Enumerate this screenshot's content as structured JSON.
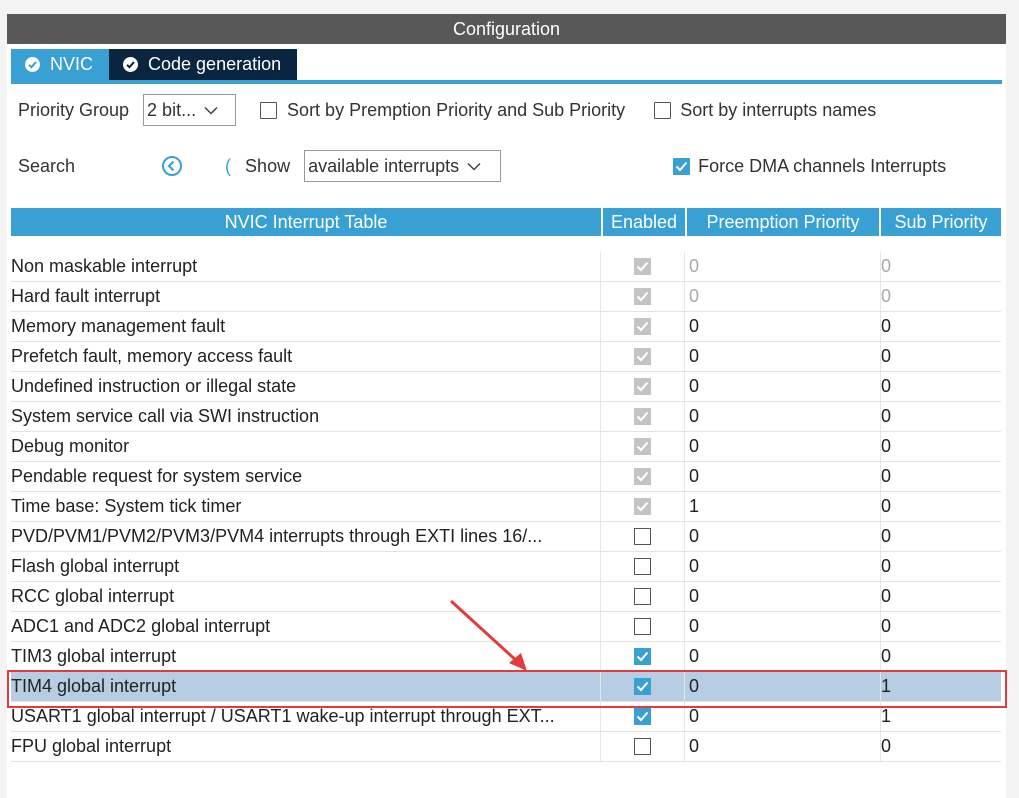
{
  "header": {
    "title": "Configuration"
  },
  "tabs": [
    {
      "label": "NVIC",
      "active": true,
      "icon": "check-circle-icon"
    },
    {
      "label": "Code generation",
      "active": false,
      "icon": "check-circle-icon"
    }
  ],
  "controls": {
    "priority_group_label": "Priority Group",
    "priority_group_value": "2 bit...",
    "sort_premption_label": "Sort by Premption Priority and Sub Priority",
    "sort_premption_checked": false,
    "sort_names_label": "Sort by interrupts names",
    "sort_names_checked": false,
    "search_label": "Search",
    "search_prev_icon": "chevron-left-circle-icon",
    "search_next_glyph": "(",
    "show_label": "Show",
    "show_value": "available interrupts",
    "force_dma_label": "Force DMA channels Interrupts",
    "force_dma_checked": true
  },
  "table": {
    "headers": {
      "name": "NVIC Interrupt Table",
      "enabled": "Enabled",
      "preemption": "Preemption Priority",
      "sub": "Sub Priority"
    },
    "rows": [
      {
        "name": "Non maskable interrupt",
        "enabled": "locked",
        "preemption": "0",
        "sub": "0",
        "muted": true
      },
      {
        "name": "Hard fault interrupt",
        "enabled": "locked",
        "preemption": "0",
        "sub": "0",
        "muted": true
      },
      {
        "name": "Memory management fault",
        "enabled": "locked",
        "preemption": "0",
        "sub": "0"
      },
      {
        "name": "Prefetch fault, memory access fault",
        "enabled": "locked",
        "preemption": "0",
        "sub": "0"
      },
      {
        "name": "Undefined instruction or illegal state",
        "enabled": "locked",
        "preemption": "0",
        "sub": "0"
      },
      {
        "name": "System service call via SWI instruction",
        "enabled": "locked",
        "preemption": "0",
        "sub": "0"
      },
      {
        "name": "Debug monitor",
        "enabled": "locked",
        "preemption": "0",
        "sub": "0"
      },
      {
        "name": "Pendable request for system service",
        "enabled": "locked",
        "preemption": "0",
        "sub": "0"
      },
      {
        "name": "Time base: System tick timer",
        "enabled": "locked",
        "preemption": "1",
        "sub": "0"
      },
      {
        "name": "PVD/PVM1/PVM2/PVM3/PVM4 interrupts through EXTI lines 16/...",
        "enabled": "off",
        "preemption": "0",
        "sub": "0"
      },
      {
        "name": "Flash global interrupt",
        "enabled": "off",
        "preemption": "0",
        "sub": "0"
      },
      {
        "name": "RCC global interrupt",
        "enabled": "off",
        "preemption": "0",
        "sub": "0"
      },
      {
        "name": "ADC1 and ADC2 global interrupt",
        "enabled": "off",
        "preemption": "0",
        "sub": "0"
      },
      {
        "name": "TIM3 global interrupt",
        "enabled": "on",
        "preemption": "0",
        "sub": "0"
      },
      {
        "name": "TIM4 global interrupt",
        "enabled": "on",
        "preemption": "0",
        "sub": "1",
        "selected": true
      },
      {
        "name": "USART1 global interrupt / USART1 wake-up interrupt through EXT...",
        "enabled": "on",
        "preemption": "0",
        "sub": "1"
      },
      {
        "name": "FPU global interrupt",
        "enabled": "off",
        "preemption": "0",
        "sub": "0"
      }
    ]
  },
  "annotation": {
    "color": "#e33b3b"
  },
  "colors": {
    "accent": "#39a0d4",
    "tab_dark": "#0a2540",
    "selected_row": "#b7cde4",
    "header_bar": "#585858"
  }
}
